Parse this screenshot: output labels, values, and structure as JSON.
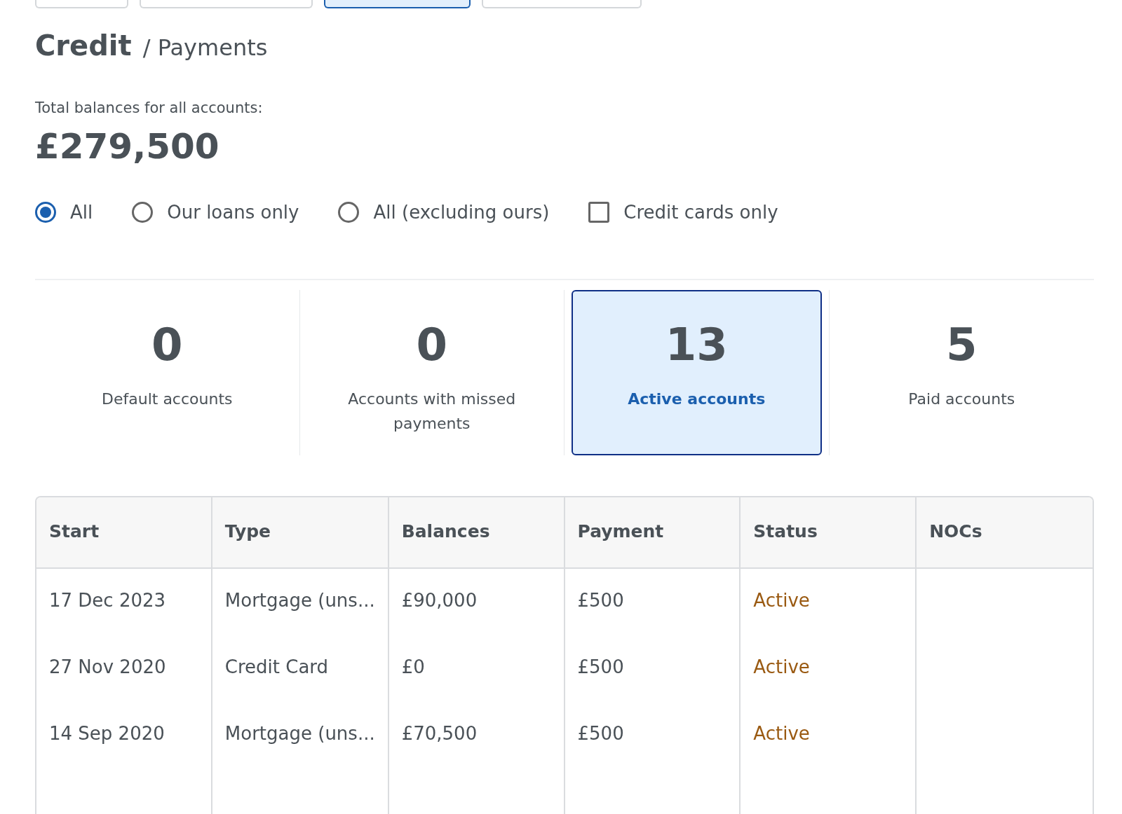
{
  "top_tabs": [
    {
      "selected": false
    },
    {
      "selected": false
    },
    {
      "selected": true
    },
    {
      "selected": false
    }
  ],
  "heading": {
    "title": "Credit",
    "subtitle": "/ Payments"
  },
  "total": {
    "label": "Total balances for all accounts:",
    "value": "£279,500"
  },
  "filters": [
    {
      "kind": "radio",
      "label": "All",
      "checked": true
    },
    {
      "kind": "radio",
      "label": "Our loans only",
      "checked": false
    },
    {
      "kind": "radio",
      "label": "All (excluding ours)",
      "checked": false
    },
    {
      "kind": "checkbox",
      "label": "Credit cards only",
      "checked": false
    }
  ],
  "summary_cards": [
    {
      "count": "0",
      "label": "Default accounts",
      "selected": false
    },
    {
      "count": "0",
      "label": "Accounts with missed payments",
      "selected": false
    },
    {
      "count": "13",
      "label": "Active accounts",
      "selected": true
    },
    {
      "count": "5",
      "label": "Paid accounts",
      "selected": false
    }
  ],
  "table": {
    "columns": [
      "Start",
      "Type",
      "Balances",
      "Payment",
      "Status",
      "NOCs"
    ],
    "rows": [
      {
        "start": "17 Dec 2023",
        "type": "Mortgage (uns...",
        "balance": "£90,000",
        "payment": "£500",
        "status": "Active"
      },
      {
        "start": "27 Nov 2020",
        "type": "Credit Card",
        "balance": "£0",
        "payment": "£500",
        "status": "Active"
      },
      {
        "start": "14 Sep 2020",
        "type": "Mortgage (uns...",
        "balance": "£70,500",
        "payment": "£500",
        "status": "Active"
      }
    ]
  }
}
